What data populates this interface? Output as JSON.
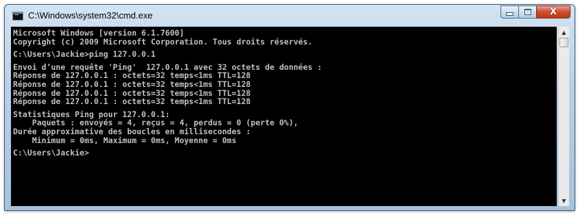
{
  "window": {
    "title": "C:\\Windows\\system32\\cmd.exe",
    "icon": "cmd-icon",
    "controls": {
      "minimize_icon": "minimize-icon",
      "maximize_icon": "maximize-icon",
      "close_glyph": "X"
    }
  },
  "colors": {
    "console_bg": "#000000",
    "console_text": "#c0c0c0",
    "close_red": "#c94326"
  },
  "console": {
    "header_line1": "Microsoft Windows [version 6.1.7600]",
    "header_line2": "Copyright (c) 2009 Microsoft Corporation. Tous droits réservés.",
    "prompt1": "C:\\Users\\Jackie>ping 127.0.0.1",
    "send_line": "Envoi d’une requête 'Ping'  127.0.0.1 avec 32 octets de données :",
    "replies": [
      "Réponse de 127.0.0.1 : octets=32 temps<1ms TTL=128",
      "Réponse de 127.0.0.1 : octets=32 temps<1ms TTL=128",
      "Réponse de 127.0.0.1 : octets=32 temps<1ms TTL=128",
      "Réponse de 127.0.0.1 : octets=32 temps<1ms TTL=128"
    ],
    "stats_title": "Statistiques Ping pour 127.0.0.1:",
    "stats_packets": "    Paquets : envoyés = 4, reçus = 4, perdus = 0 (perte 0%),",
    "rtt_title": "Durée approximative des boucles en millisecondes :",
    "rtt_values": "    Minimum = 0ms, Maximum = 0ms, Moyenne = 0ms",
    "prompt2": "C:\\Users\\Jackie>"
  },
  "scrollbar": {
    "up_icon": "▲",
    "down_icon": "▼"
  }
}
